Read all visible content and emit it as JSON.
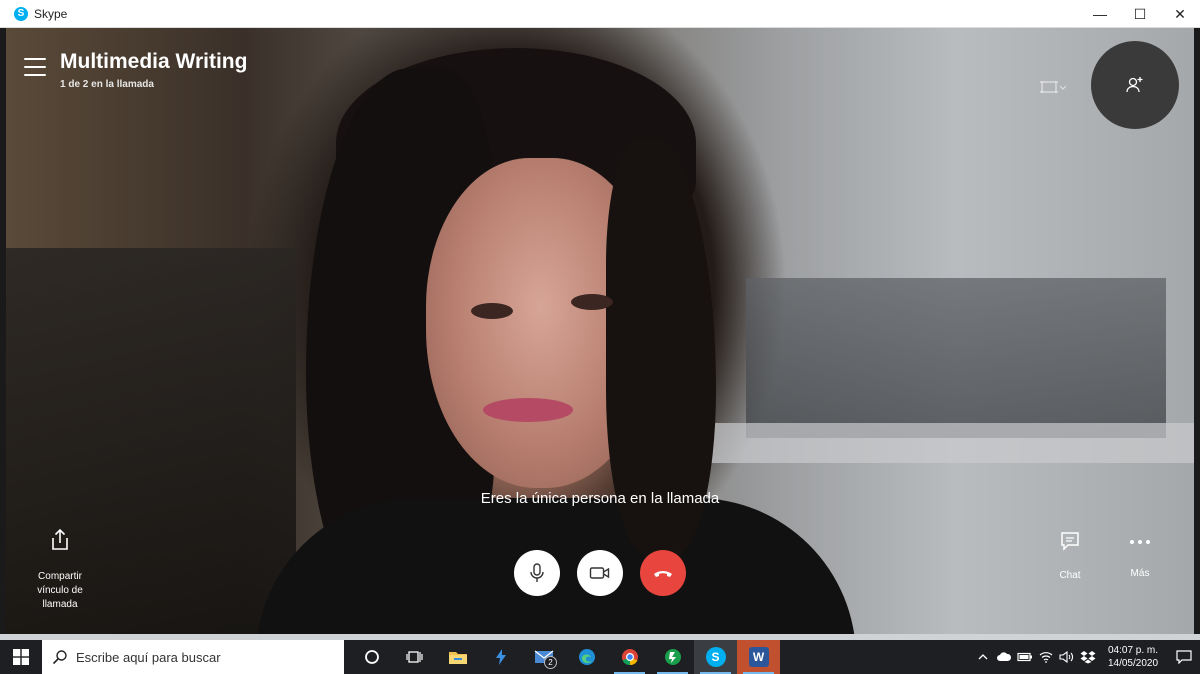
{
  "window": {
    "app_title": "Skype",
    "app_logo_letter": "S",
    "minimize_glyph": "—",
    "maximize_glyph": "☐",
    "close_glyph": "✕"
  },
  "call": {
    "title": "Multimedia Writing",
    "subtitle": "1 de 2 en la llamada",
    "alone_message": "Eres la única persona en la llamada",
    "share_link_label": "Compartir vínculo de llamada",
    "chat_label": "Chat",
    "more_label": "Más"
  },
  "icons": {
    "menu": "hamburger-menu-icon",
    "layout": "layout-icon",
    "add_person": "add-person-icon",
    "share": "share-icon",
    "mic": "microphone-icon",
    "video": "video-camera-icon",
    "hangup": "hang-up-icon",
    "chat": "chat-icon",
    "more": "more-dots-icon"
  },
  "colors": {
    "hangup": "#e8453f",
    "skype_blue": "#00aff0",
    "taskbar": "#1d1f22"
  },
  "taskbar": {
    "search_placeholder": "Escribe aquí para buscar",
    "mail_badge": "2",
    "skype_letter": "S",
    "word_letter": "W",
    "time": "04:07 p. m.",
    "date": "14/05/2020"
  }
}
